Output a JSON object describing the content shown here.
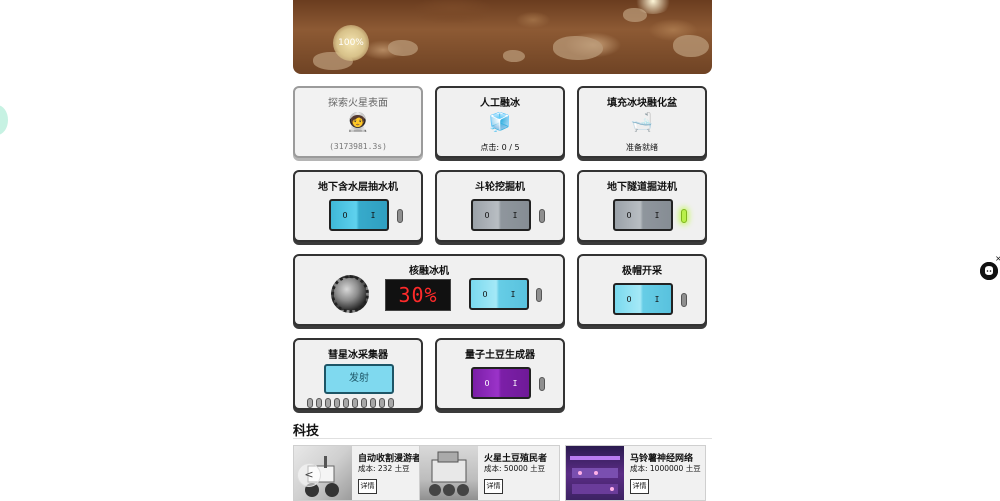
{
  "hero": {
    "badge": "100%"
  },
  "cards": {
    "explore": {
      "title": "探索火星表面",
      "icon": "🧑‍🚀",
      "sub": "(3173981.3s)"
    },
    "artificial_melt": {
      "title": "人工融冰",
      "icon": "🧊",
      "sub": "点击: 0 / 5"
    },
    "fill_tub": {
      "title": "填充冰块融化盆",
      "icon": "🛁",
      "sub": "准备就绪"
    },
    "pump": {
      "title": "地下含水层抽水机",
      "off": "O",
      "on": "I"
    },
    "bucket": {
      "title": "斗轮挖掘机",
      "off": "O",
      "on": "I"
    },
    "tunnel": {
      "title": "地下隧道掘进机",
      "off": "O",
      "on": "I"
    },
    "nuclear": {
      "title": "核融冰机",
      "percent": "30%",
      "off": "O",
      "on": "I"
    },
    "polar": {
      "title": "极帽开采",
      "off": "O",
      "on": "I"
    },
    "comet": {
      "title": "彗星冰采集器",
      "button": "发射"
    },
    "quantum": {
      "title": "量子土豆生成器",
      "off": "O",
      "on": "I"
    }
  },
  "tech": {
    "heading": "科技",
    "prev": "<",
    "items": [
      {
        "name": "自动收割漫游者",
        "cost": "成本: 232 土豆",
        "button": "详情"
      },
      {
        "name": "火星土豆殖民者",
        "cost": "成本: 50000 土豆",
        "button": "详情"
      },
      {
        "name": "马铃薯神经网络",
        "cost": "成本: 1000000 土豆",
        "button": "详情"
      }
    ]
  },
  "corner": {
    "close": "×",
    "icon": "github-icon"
  },
  "colors": {
    "lcd_text": "#ff2a2a",
    "quantum": "#7a1ea7",
    "switch_cyan": "#3fb8d8",
    "indicator_on": "#b9f04a"
  }
}
